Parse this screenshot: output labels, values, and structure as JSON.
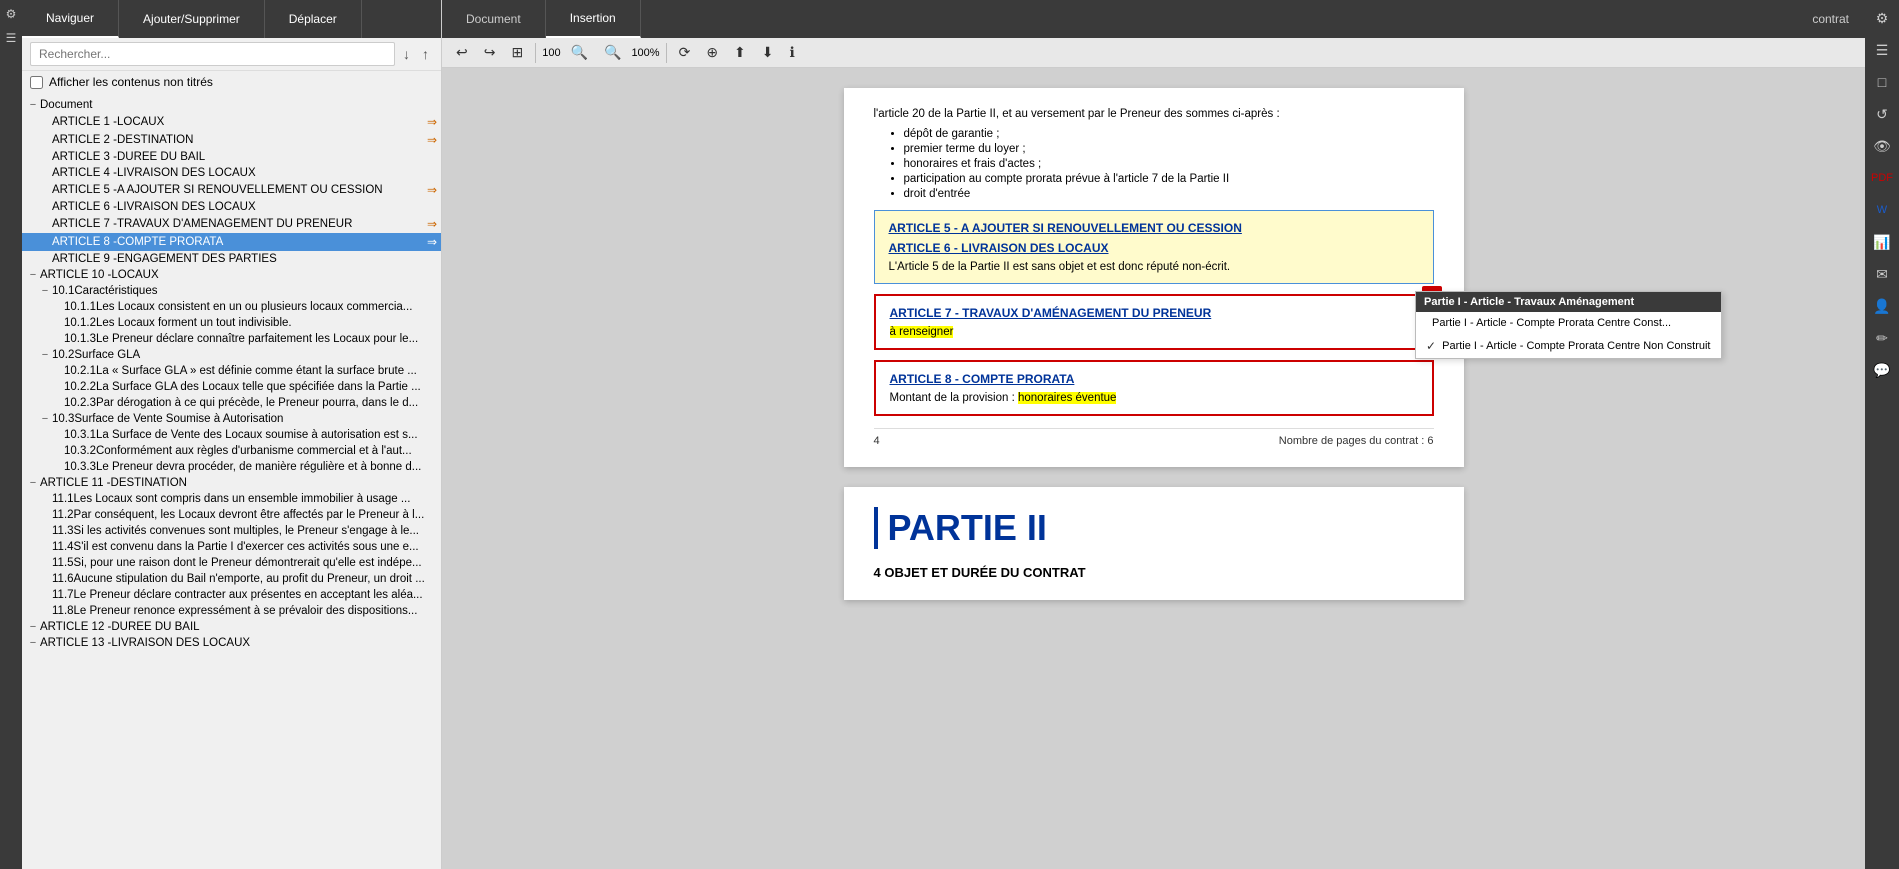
{
  "sidebar": {
    "nav_tabs": [
      "Naviguer",
      "Ajouter/Supprimer",
      "Déplacer"
    ],
    "search_placeholder": "Rechercher...",
    "show_untitled": "Afficher les contenus non titrés",
    "tree": [
      {
        "id": "doc-root",
        "label": "Document",
        "level": 0,
        "toggle": "minus",
        "is_root": true
      },
      {
        "id": "art1",
        "label": "ARTICLE 1 -LOCAUX",
        "level": 1,
        "bookmark": true
      },
      {
        "id": "art2",
        "label": "ARTICLE 2 -DESTINATION",
        "level": 1,
        "bookmark": true
      },
      {
        "id": "art3",
        "label": "ARTICLE 3 -DURÉE DU BAIL",
        "level": 1
      },
      {
        "id": "art4",
        "label": "ARTICLE 4 -LIVRAISON DES LOCAUX",
        "level": 1
      },
      {
        "id": "art5",
        "label": "ARTICLE 5 -A AJOUTER SI RENOUVELLEMENT OU CESSION",
        "level": 1,
        "bookmark": true
      },
      {
        "id": "art6",
        "label": "ARTICLE 6 -LIVRAISON DES LOCAUX",
        "level": 1
      },
      {
        "id": "art7",
        "label": "ARTICLE 7 -TRAVAUX D'AMÉNAGEMENT DU PRENEUR",
        "level": 1,
        "bookmark": true
      },
      {
        "id": "art8",
        "label": "ARTICLE 8 -COMPTE PRORATA",
        "level": 1,
        "selected": true,
        "bookmark": true
      },
      {
        "id": "art9",
        "label": "ARTICLE 9 -ENGAGEMENT DES PARTIES",
        "level": 1
      },
      {
        "id": "art10",
        "label": "ARTICLE 10 -LOCAUX",
        "level": 0,
        "toggle": "minus"
      },
      {
        "id": "art10-1",
        "label": "10.1Caractéristiques",
        "level": 1,
        "toggle": "minus"
      },
      {
        "id": "art10-1-1",
        "label": "10.1.1Les Locaux consistent en un ou plusieurs locaux commercia...",
        "level": 2
      },
      {
        "id": "art10-1-2",
        "label": "10.1.2Les Locaux forment un tout indivisible.",
        "level": 2
      },
      {
        "id": "art10-1-3",
        "label": "10.1.3Le Preneur déclare connaître parfaitement les Locaux pour le...",
        "level": 2
      },
      {
        "id": "art10-2",
        "label": "10.2Surface GLA",
        "level": 1,
        "toggle": "minus"
      },
      {
        "id": "art10-2-1",
        "label": "10.2.1La « Surface GLA » est définie comme étant la surface brute ...",
        "level": 2
      },
      {
        "id": "art10-2-2",
        "label": "10.2.2La Surface GLA des Locaux telle que spécifiée dans la Partie ...",
        "level": 2
      },
      {
        "id": "art10-2-3",
        "label": "10.2.3Par dérogation à ce qui précède, le Preneur pourra, dans le d...",
        "level": 2
      },
      {
        "id": "art10-3",
        "label": "10.3Surface de Vente Soumise à Autorisation",
        "level": 1,
        "toggle": "minus"
      },
      {
        "id": "art10-3-1",
        "label": "10.3.1La Surface de Vente des Locaux soumise à autorisation est s...",
        "level": 2
      },
      {
        "id": "art10-3-2",
        "label": "10.3.2Conformément aux règles d'urbanisme commercial et à l'aut...",
        "level": 2
      },
      {
        "id": "art10-3-3",
        "label": "10.3.3Le Preneur devra procéder, de manière régulière et à bonne d...",
        "level": 2
      },
      {
        "id": "art11",
        "label": "ARTICLE 11 -DESTINATION",
        "level": 0,
        "toggle": "minus"
      },
      {
        "id": "art11-1",
        "label": "11.1Les Locaux sont compris dans un ensemble immobilier à usage ...",
        "level": 1
      },
      {
        "id": "art11-2",
        "label": "11.2Par conséquent, les Locaux devront être affectés par le Preneur à l...",
        "level": 1
      },
      {
        "id": "art11-3",
        "label": "11.3Si les activités convenues sont multiples, le Preneur s'engage à le...",
        "level": 1
      },
      {
        "id": "art11-4",
        "label": "11.4S'il est convenu dans  la Partie I d'exercer ces activités sous une e...",
        "level": 1
      },
      {
        "id": "art11-5",
        "label": "11.5Si, pour une raison dont le Preneur démontrerait qu'elle est indépe...",
        "level": 1
      },
      {
        "id": "art11-6",
        "label": "11.6Aucune stipulation du Bail n'emporte, au profit du Preneur, un droit ...",
        "level": 1
      },
      {
        "id": "art11-7",
        "label": "11.7Le Preneur déclare contracter aux présentes en acceptant les aléa...",
        "level": 1
      },
      {
        "id": "art11-8",
        "label": "11.8Le Preneur renonce expressément à se prévaloir des dispositions...",
        "level": 1
      },
      {
        "id": "art12",
        "label": "ARTICLE 12 -DURÉE DU BAIL",
        "level": 0,
        "toggle": "minus"
      },
      {
        "id": "art13",
        "label": "ARTICLE 13 -LIVRAISON DES LOCAUX",
        "level": 0,
        "toggle": "minus"
      }
    ]
  },
  "main": {
    "tabs": [
      "Document",
      "Insertion"
    ],
    "active_tab": "Insertion",
    "title_right": "contrat",
    "toolbar": {
      "zoom_value": "100",
      "zoom_percent": "100%"
    },
    "doc": {
      "intro_text": "l'article 20 de la Partie II,  et au versement par le Preneur des sommes ci-après :",
      "bullets": [
        "dépôt de garantie ;",
        "premier terme du loyer ;",
        "honoraires et frais d'actes ;",
        "participation au compte prorata prévue à l'article 7 de la Partie II",
        "droit d'entrée"
      ],
      "article5_title": "ARTICLE 5 - A AJOUTER SI RENOUVELLEMENT OU CESSION",
      "article6_title": "ARTICLE 6 - LIVRAISON DES LOCAUX",
      "article6_body": "L'Article 5 de la Partie II est sans objet et est donc réputé non-écrit.",
      "article7_title": "ARTICLE 7 - TRAVAUX D'AMÉNAGEMENT DU PRENEUR",
      "article7_placeholder": "à renseigner",
      "article8_title": "ARTICLE 8 - COMPTE PRORATA",
      "article8_body_prefix": "Montant de la provision : ",
      "article8_body_value": "honoraires éventue",
      "page_number": "4",
      "page_info": "Nombre de pages du contrat : 6",
      "partie2_title": "PARTIE II",
      "partie2_subtitle": "4    OBJET ET DURÉE DU CONTRAT"
    },
    "tooltip": {
      "header": "Partie I - Article - Travaux Aménagement",
      "items": [
        {
          "label": "Partie I - Article - Compte Prorata Centre Const...",
          "checked": false
        },
        {
          "label": "Partie I - Article - Compte Prorata Centre Non Construit",
          "checked": true
        }
      ]
    }
  },
  "right_icons": [
    "⚙",
    "☰",
    "□",
    "↺",
    "👁",
    "📄",
    "W",
    "📊",
    "✉",
    "👤",
    "✏",
    "💬"
  ],
  "left_sidebar_icons": [
    "⚙",
    "☰"
  ]
}
